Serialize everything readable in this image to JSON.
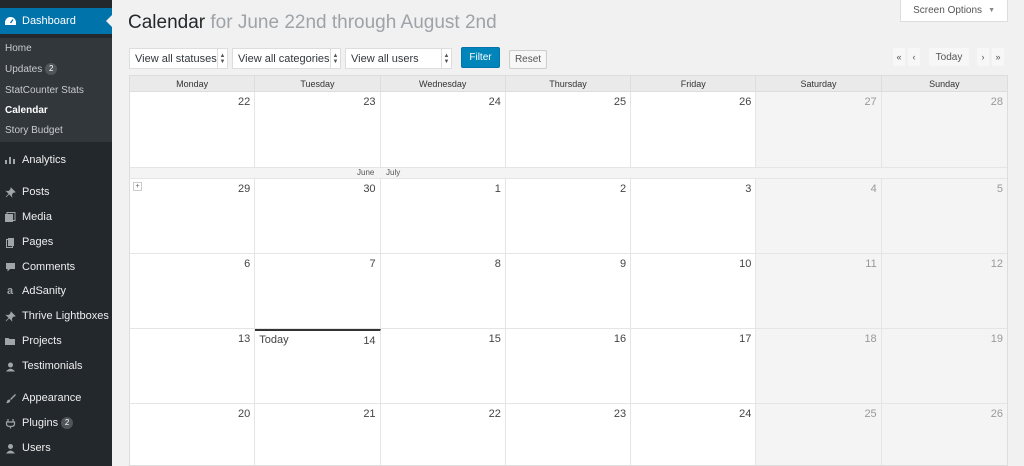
{
  "sidebar": {
    "dashboard_label": "Dashboard",
    "submenu": [
      {
        "label": "Home"
      },
      {
        "label": "Updates",
        "badge": "2"
      },
      {
        "label": "StatCounter Stats"
      },
      {
        "label": "Calendar"
      },
      {
        "label": "Story Budget"
      }
    ],
    "items": [
      {
        "label": "Analytics",
        "icon": "analytics-icon"
      },
      {
        "label": "Posts",
        "icon": "pin-icon"
      },
      {
        "label": "Media",
        "icon": "media-icon"
      },
      {
        "label": "Pages",
        "icon": "pages-icon"
      },
      {
        "label": "Comments",
        "icon": "comments-icon"
      },
      {
        "label": "AdSanity",
        "icon": "adsanity-icon"
      },
      {
        "label": "Thrive Lightboxes",
        "icon": "pin-icon"
      },
      {
        "label": "Projects",
        "icon": "folder-icon"
      },
      {
        "label": "Testimonials",
        "icon": "testimonial-icon"
      },
      {
        "label": "Appearance",
        "icon": "brush-icon"
      },
      {
        "label": "Plugins",
        "icon": "plug-icon",
        "badge": "2"
      },
      {
        "label": "Users",
        "icon": "users-icon"
      }
    ]
  },
  "header": {
    "title": "Calendar",
    "range": "for June 22nd through August 2nd",
    "screen_options": "Screen Options"
  },
  "filters": {
    "statuses": "View all statuses",
    "categories": "View all categories",
    "users": "View all users",
    "filter_label": "Filter",
    "reset_label": "Reset"
  },
  "nav": {
    "first": "«",
    "prev": "‹",
    "today": "Today",
    "next": "›",
    "last": "»"
  },
  "calendar": {
    "days": [
      "Monday",
      "Tuesday",
      "Wednesday",
      "Thursday",
      "Friday",
      "Saturday",
      "Sunday"
    ],
    "month_june": "June",
    "month_july": "July",
    "today_label": "Today",
    "weeks": [
      [
        "22",
        "23",
        "24",
        "25",
        "26",
        "27",
        "28"
      ],
      [
        "29",
        "30",
        "1",
        "2",
        "3",
        "4",
        "5"
      ],
      [
        "6",
        "7",
        "8",
        "9",
        "10",
        "11",
        "12"
      ],
      [
        "13",
        "14",
        "15",
        "16",
        "17",
        "18",
        "19"
      ],
      [
        "20",
        "21",
        "22",
        "23",
        "24",
        "25",
        "26"
      ]
    ]
  },
  "colors": {
    "sidebar_bg": "#23282d",
    "accent": "#0073aa",
    "filter_button": "#0085ba"
  }
}
